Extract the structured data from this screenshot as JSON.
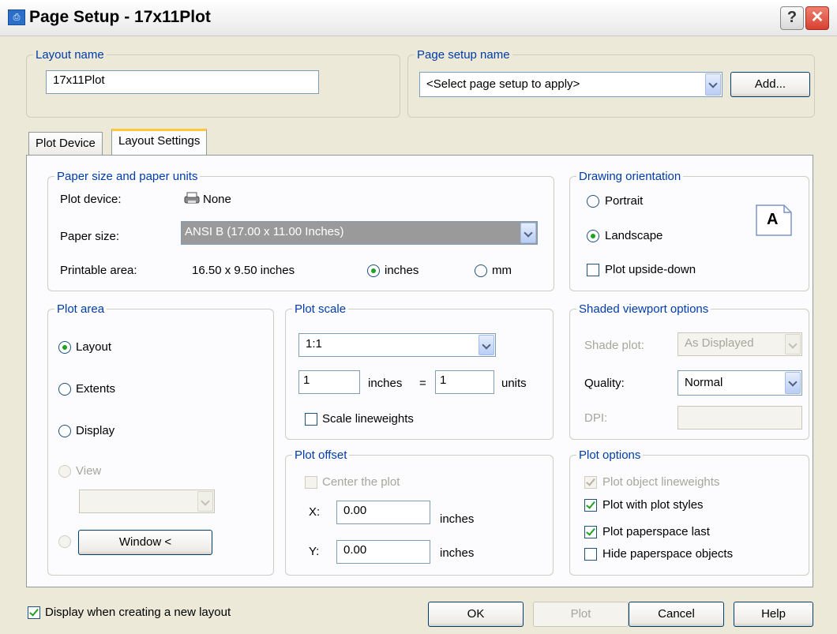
{
  "window": {
    "title": "Page Setup - 17x11Plot",
    "help_glyph": "?",
    "close_glyph": "✕"
  },
  "layout_name": {
    "legend": "Layout name",
    "value": "17x11Plot"
  },
  "page_setup_name": {
    "legend": "Page setup name",
    "selected": "<Select page setup to apply>",
    "add_button": "Add..."
  },
  "tabs": [
    {
      "label": "Plot Device",
      "active": false
    },
    {
      "label": "Layout Settings",
      "active": true
    }
  ],
  "paper": {
    "legend": "Paper size and paper units",
    "plot_device_label": "Plot device:",
    "plot_device_value": "None",
    "paper_size_label": "Paper size:",
    "paper_size_value": "ANSI B (17.00 x 11.00 Inches)",
    "printable_area_label": "Printable area:",
    "printable_area_value": "16.50 x 9.50 inches",
    "unit_inches": "inches",
    "unit_mm": "mm",
    "selected_unit": "inches"
  },
  "orientation": {
    "legend": "Drawing orientation",
    "portrait": "Portrait",
    "landscape": "Landscape",
    "upside_down": "Plot upside-down",
    "selected": "Landscape",
    "icon_letter": "A"
  },
  "plot_area": {
    "legend": "Plot area",
    "layout": "Layout",
    "extents": "Extents",
    "display": "Display",
    "view": "View",
    "view_value": "",
    "window_button": "Window <",
    "selected": "Layout"
  },
  "plot_scale": {
    "legend": "Plot scale",
    "scale_value": "1:1",
    "inches_value": "1",
    "inches_label": "inches",
    "equals": "=",
    "units_value": "1",
    "units_label": "units",
    "scale_lineweights": "Scale lineweights"
  },
  "plot_offset": {
    "legend": "Plot offset",
    "center": "Center the plot",
    "x_label": "X:",
    "x_value": "0.00",
    "x_unit": "inches",
    "y_label": "Y:",
    "y_value": "0.00",
    "y_unit": "inches"
  },
  "shaded": {
    "legend": "Shaded viewport options",
    "shade_plot_label": "Shade plot:",
    "shade_plot_value": "As Displayed",
    "quality_label": "Quality:",
    "quality_value": "Normal",
    "dpi_label": "DPI:",
    "dpi_value": ""
  },
  "plot_options": {
    "legend": "Plot options",
    "object_lineweights": "Plot object lineweights",
    "with_plot_styles": "Plot with plot styles",
    "paperspace_last": "Plot paperspace last",
    "hide_paperspace": "Hide paperspace objects"
  },
  "footer": {
    "display_new_layout": "Display when creating a new layout",
    "ok": "OK",
    "plot": "Plot",
    "cancel": "Cancel",
    "help": "Help"
  },
  "colors": {
    "legend_text": "#003ca8",
    "dialog_bg": "#ece9d8",
    "panel_bg": "#fcfcfe",
    "check_mark": "#21a121",
    "tab_highlight": "#ffc83c"
  },
  "icons": {
    "app": "page-setup-app-icon",
    "printer": "printer-icon",
    "orientation": "landscape-page-icon"
  }
}
